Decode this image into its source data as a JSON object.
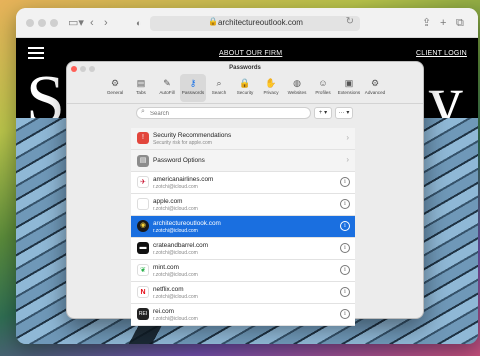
{
  "browser": {
    "url": "architectureoutlook.com"
  },
  "webpage": {
    "nav_left": "ABOUT OUR FIRM",
    "nav_right": "CLIENT LOGIN",
    "hero_left_letter": "S",
    "hero_right_letter": "y"
  },
  "prefs": {
    "title": "Passwords",
    "tabs": [
      {
        "label": "General",
        "icon": "gear-icon"
      },
      {
        "label": "Tabs",
        "icon": "tabs-icon"
      },
      {
        "label": "AutoFill",
        "icon": "autofill-icon"
      },
      {
        "label": "Passwords",
        "icon": "key-icon"
      },
      {
        "label": "Search",
        "icon": "search-icon"
      },
      {
        "label": "Security",
        "icon": "lock-icon"
      },
      {
        "label": "Privacy",
        "icon": "hand-icon"
      },
      {
        "label": "Websites",
        "icon": "globe-icon"
      },
      {
        "label": "Profiles",
        "icon": "person-icon"
      },
      {
        "label": "Extensions",
        "icon": "puzzle-icon"
      },
      {
        "label": "Advanced",
        "icon": "gears-icon"
      }
    ],
    "active_tab": "Passwords",
    "search_placeholder": "Search",
    "add_button": "+ ▾",
    "more_button": "··· ▾",
    "security_title": "Security Recommendations",
    "security_subtitle": "Security risk for apple.com",
    "options_title": "Password Options",
    "accounts": [
      {
        "site": "americanairlines.com",
        "email": "r.zotchi@icloud.com",
        "selected": false,
        "color": "#c8102e"
      },
      {
        "site": "apple.com",
        "email": "r.zotchi@icloud.com",
        "selected": false,
        "color": "#555555"
      },
      {
        "site": "architectureoutlook.com",
        "email": "r.zotchi@icloud.com",
        "selected": true,
        "color": "#1a1a1a"
      },
      {
        "site": "crateandbarrel.com",
        "email": "r.zotchi@icloud.com",
        "selected": false,
        "color": "#111111"
      },
      {
        "site": "mint.com",
        "email": "r.zotchi@icloud.com",
        "selected": false,
        "color": "#2ab14a"
      },
      {
        "site": "netflix.com",
        "email": "r.zotchi@icloud.com",
        "selected": false,
        "color": "#e50914"
      },
      {
        "site": "rei.com",
        "email": "r.zotchi@icloud.com",
        "selected": false,
        "color": "#222222"
      }
    ]
  }
}
